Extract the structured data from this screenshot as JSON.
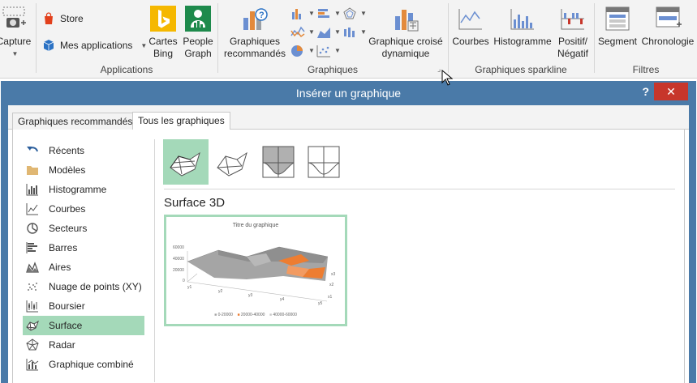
{
  "ribbon": {
    "capture": "Capture",
    "store": "Store",
    "my_apps": "Mes applications",
    "bing_line1": "Cartes",
    "bing_line2": "Bing",
    "people_line1": "People",
    "people_line2": "Graph",
    "applications_group": "Applications",
    "recommended_line1": "Graphiques",
    "recommended_line2": "recommandés",
    "pivot_line1": "Graphique croisé",
    "pivot_line2": "dynamique",
    "charts_group": "Graphiques",
    "sparkline_lines": "Courbes",
    "sparkline_column": "Histogramme",
    "sparkline_winloss_line1": "Positif/",
    "sparkline_winloss_line2": "Négatif",
    "sparklines_group": "Graphiques sparkline",
    "slicer": "Segment",
    "timeline": "Chronologie",
    "filters_group": "Filtres"
  },
  "dialog": {
    "title": "Insérer un graphique",
    "help": "?",
    "close": "✕",
    "tabs": [
      {
        "label": "Graphiques recommandés"
      },
      {
        "label": "Tous les graphiques"
      }
    ],
    "categories": [
      {
        "label": "Récents",
        "icon": "undo-icon"
      },
      {
        "label": "Modèles",
        "icon": "folder-icon"
      },
      {
        "label": "Histogramme",
        "icon": "column-chart-icon"
      },
      {
        "label": "Courbes",
        "icon": "line-chart-icon"
      },
      {
        "label": "Secteurs",
        "icon": "pie-chart-icon"
      },
      {
        "label": "Barres",
        "icon": "bar-chart-icon"
      },
      {
        "label": "Aires",
        "icon": "area-chart-icon"
      },
      {
        "label": "Nuage de points (XY)",
        "icon": "scatter-chart-icon"
      },
      {
        "label": "Boursier",
        "icon": "stock-chart-icon"
      },
      {
        "label": "Surface",
        "icon": "surface-chart-icon"
      },
      {
        "label": "Radar",
        "icon": "radar-chart-icon"
      },
      {
        "label": "Graphique combiné",
        "icon": "combo-chart-icon"
      }
    ],
    "selected_category": "Surface",
    "subtype_title": "Surface 3D",
    "preview": {
      "title": "Titre du graphique",
      "y_ticks": [
        "60000",
        "40000",
        "20000",
        "0"
      ],
      "x_ticks": [
        "y1",
        "y2",
        "y3",
        "y4",
        "y5"
      ],
      "z_ticks": [
        "x1",
        "x2",
        "x3"
      ],
      "legend": [
        "0-20000",
        "20000-40000",
        "40000-60000"
      ]
    }
  },
  "colors": {
    "accent_green": "#a4d9b9",
    "dialog_blue": "#4a7aa8",
    "close_red": "#c7362b",
    "surface_orange": "#ed7d31",
    "surface_gray": "#a5a5a5"
  }
}
